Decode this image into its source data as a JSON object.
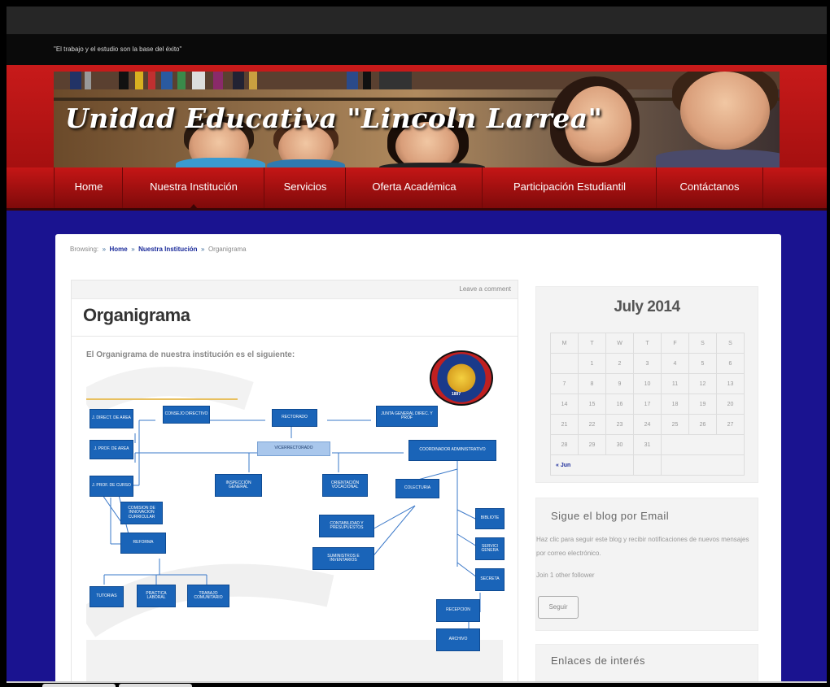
{
  "site": {
    "tagline": "\"El trabajo y el estudio son la base del éxito\"",
    "title": "Unidad Educativa \"Lincoln Larrea\""
  },
  "nav": {
    "items": [
      {
        "label": "Home"
      },
      {
        "label": "Nuestra Institución"
      },
      {
        "label": "Servicios"
      },
      {
        "label": "Oferta Académica"
      },
      {
        "label": "Participación Estudiantil"
      },
      {
        "label": "Contáctanos"
      }
    ]
  },
  "breadcrumb": {
    "prefix": "Browsing:",
    "home": "Home",
    "section": "Nuestra Institución",
    "current": "Organigrama"
  },
  "post": {
    "leave_comment": "Leave a comment",
    "title": "Organigrama",
    "intro": "El Organigrama de nuestra institución es el siguiente:"
  },
  "orgchart": {
    "boxes": {
      "direct_area": "J. DIRECT. DE AREA",
      "consejo": "CONSEJO DIRECTIVO",
      "rectorado": "RECTORADO",
      "junta": "JUNTA GENERAL DIREC. Y PROF",
      "prof_area": "J. PROF. DE AREA",
      "vicerrectorado": "VICERRECTORADO",
      "coordinador": "COORDINADOR ADMINISTRATIVO",
      "prof_curso": "J. PROF. DE CURSO",
      "inspeccion": "INSPECCIÓN GENERAL",
      "orientacion": "ORIENTACIÓN VOCACIONAL",
      "colecturia": "COLECTURIA",
      "comision": "COMISION DE INNOVACION CURRICULAR",
      "biblioteca": "BIBLIOTE",
      "contabilidad": "CONTABILIDAD Y PRESUPUESTOS",
      "reforma": "REFORMA",
      "servicios": "SERVICI GENERA",
      "suministros": "SUMINISTROS E INVENTARIOS",
      "secretaria": "SECRETA",
      "tutorias": "TUTORIAS",
      "practica": "PRACTICA LABORAL",
      "trabajo": "TRABAJO COMUNITARIO",
      "recepcion": "RECEPCION",
      "archivo": "ARCHIVO"
    },
    "seal_year": "1897"
  },
  "calendar": {
    "title": "July 2014",
    "weekdays": [
      "M",
      "T",
      "W",
      "T",
      "F",
      "S",
      "S"
    ],
    "weeks": [
      [
        "",
        "1",
        "2",
        "3",
        "4",
        "5",
        "6"
      ],
      [
        "7",
        "8",
        "9",
        "10",
        "11",
        "12",
        "13"
      ],
      [
        "14",
        "15",
        "16",
        "17",
        "18",
        "19",
        "20"
      ],
      [
        "21",
        "22",
        "23",
        "24",
        "25",
        "26",
        "27"
      ],
      [
        "28",
        "29",
        "30",
        "31",
        "",
        "",
        ""
      ]
    ],
    "prev_link": "« Jun"
  },
  "email_widget": {
    "title": "Sigue el blog por Email",
    "text": "Haz clic para seguir este blog y recibir notificaciones de nuevos mensajes por correo electrónico.",
    "followers": "Join 1 other follower",
    "button": "Seguir"
  },
  "links_widget": {
    "title": "Enlaces de interés"
  },
  "colors": {
    "header_red": "#c81a1a",
    "page_bg": "#1a1390",
    "org_box_blue": "#1a64b8",
    "link_blue": "#1a2a9a"
  }
}
